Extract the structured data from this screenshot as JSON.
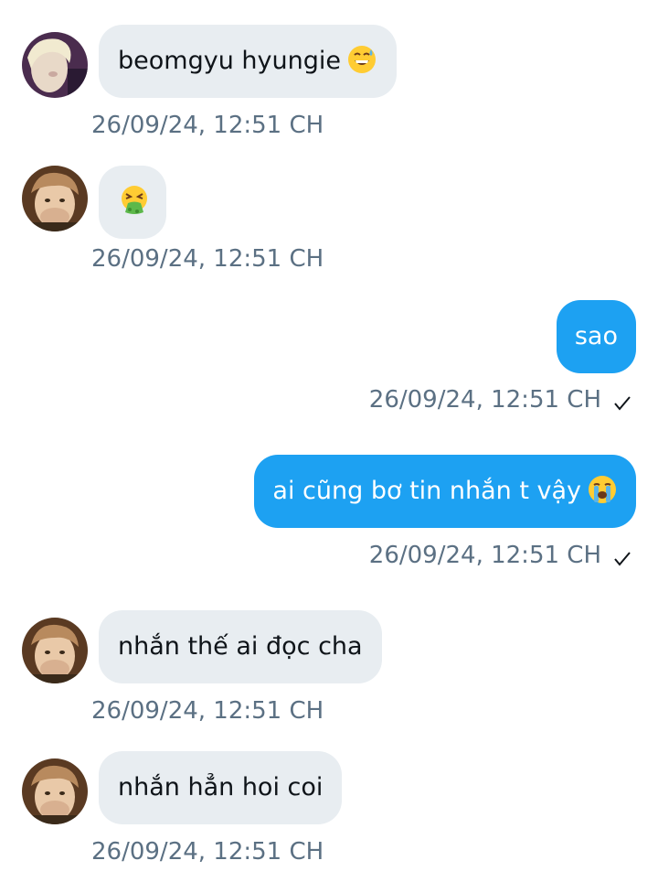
{
  "messages": [
    {
      "direction": "incoming",
      "avatar": "avatar-blond",
      "text": "beomgyu hyungie",
      "emoji": "grinning-sweat-emoji",
      "timestamp": "26/09/24, 12:51 CH"
    },
    {
      "direction": "incoming",
      "avatar": "avatar-covering-mouth",
      "text": "",
      "emoji": "vomiting-face-emoji",
      "timestamp": "26/09/24, 12:51 CH"
    },
    {
      "direction": "outgoing",
      "text": "sao",
      "timestamp": "26/09/24, 12:51 CH",
      "read_icon": "checkmark-icon"
    },
    {
      "direction": "outgoing",
      "text": "ai cũng bơ tin nhắn t vậy",
      "emoji": "loudly-crying-emoji",
      "timestamp": "26/09/24, 12:51 CH",
      "read_icon": "checkmark-icon"
    },
    {
      "direction": "incoming",
      "avatar": "avatar-covering-mouth",
      "text": "nhắn thế ai đọc cha",
      "timestamp": "26/09/24, 12:51 CH"
    },
    {
      "direction": "incoming",
      "avatar": "avatar-covering-mouth",
      "text": "nhắn hẳn hoi coi",
      "timestamp": "26/09/24, 12:51 CH"
    }
  ],
  "colors": {
    "incoming_bubble": "#e8edf1",
    "outgoing_bubble": "#1da1f2",
    "timestamp": "#5b7083",
    "text": "#0f1419"
  }
}
